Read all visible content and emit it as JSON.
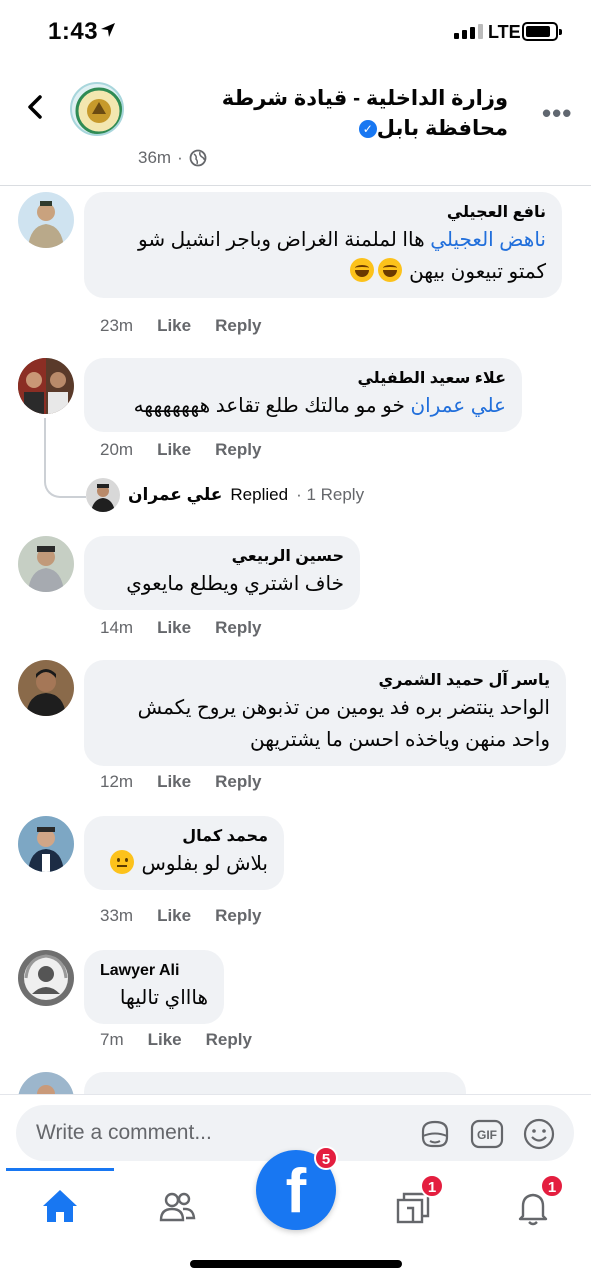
{
  "status_bar": {
    "time": "1:43",
    "network": "LTE"
  },
  "post": {
    "page_name": "وزارة الداخلية - قيادة شرطة محافظة بابل",
    "age": "36m"
  },
  "comments": [
    {
      "author": "نافع العجيلي",
      "mention": "ناهض العجيلي",
      "text_line1_rest": " هاا لملمنة الغراض وباجر انشيل شو",
      "text_line2": "كمتو تبيعون بيهن",
      "age": "23m"
    },
    {
      "author": "علاء سعيد الطفيلي",
      "mention": "علي عمران",
      "text": "  خو مو مالتك طلع تقاعد هههههههه",
      "age": "20m",
      "reply": {
        "name": "علي عمران",
        "action": "Replied",
        "count": "· 1 Reply"
      }
    },
    {
      "author": "حسين الربيعي",
      "text": "خاف اشتري ويطلع  مايعوي",
      "age": "14m"
    },
    {
      "author": "ياسر آل حميد الشمري",
      "text_line1": "الواحد ينتضر بره فد يومين من تذبوهن يروح يكمش",
      "text_line2": "واحد منهن وياخذه احسن ما يشتريهن",
      "age": "12m"
    },
    {
      "author": "محمد كمال",
      "text": "بلاش لو بفلوس",
      "age": "33m"
    },
    {
      "author": "Lawyer Ali",
      "text": "هاااي تاليها",
      "age": "7m"
    }
  ],
  "labels": {
    "like": "Like",
    "reply": "Reply"
  },
  "composer": {
    "placeholder": "Write a comment..."
  },
  "tabs": {
    "facebook_badge": "5",
    "pages_badge": "1",
    "notifications_badge": "1"
  }
}
